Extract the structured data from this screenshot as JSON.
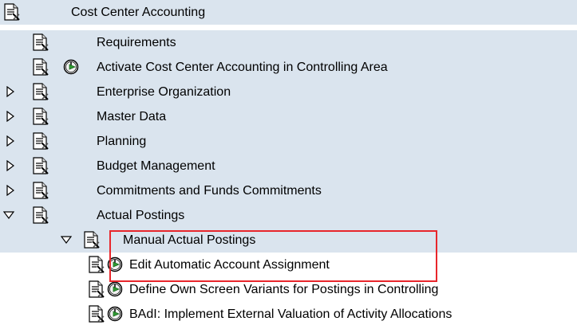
{
  "tree": {
    "root": {
      "label": "Cost Center Accounting"
    },
    "requirements": {
      "label": "Requirements"
    },
    "activate": {
      "label": "Activate Cost Center Accounting in Controlling Area"
    },
    "enterprise": {
      "label": "Enterprise Organization"
    },
    "master_data": {
      "label": "Master Data"
    },
    "planning": {
      "label": "Planning"
    },
    "budget": {
      "label": "Budget Management"
    },
    "commitments": {
      "label": "Commitments and Funds Commitments"
    },
    "actual_postings": {
      "label": "Actual Postings"
    },
    "manual_actual": {
      "label": "Manual Actual Postings"
    },
    "edit_auto": {
      "label": "Edit Automatic Account Assignment"
    },
    "screen_variants": {
      "label": "Define Own Screen Variants for Postings in Controlling"
    },
    "badi": {
      "label": "BAdI: Implement External Valuation of Activity Allocations"
    }
  },
  "icons": {
    "document": "img-document-icon",
    "execute": "clock-execute-icon",
    "expand": "triangle-right-icon",
    "collapse": "triangle-down-icon"
  },
  "colors": {
    "row_background": "#dae4ee",
    "highlight": "#e8262b"
  }
}
